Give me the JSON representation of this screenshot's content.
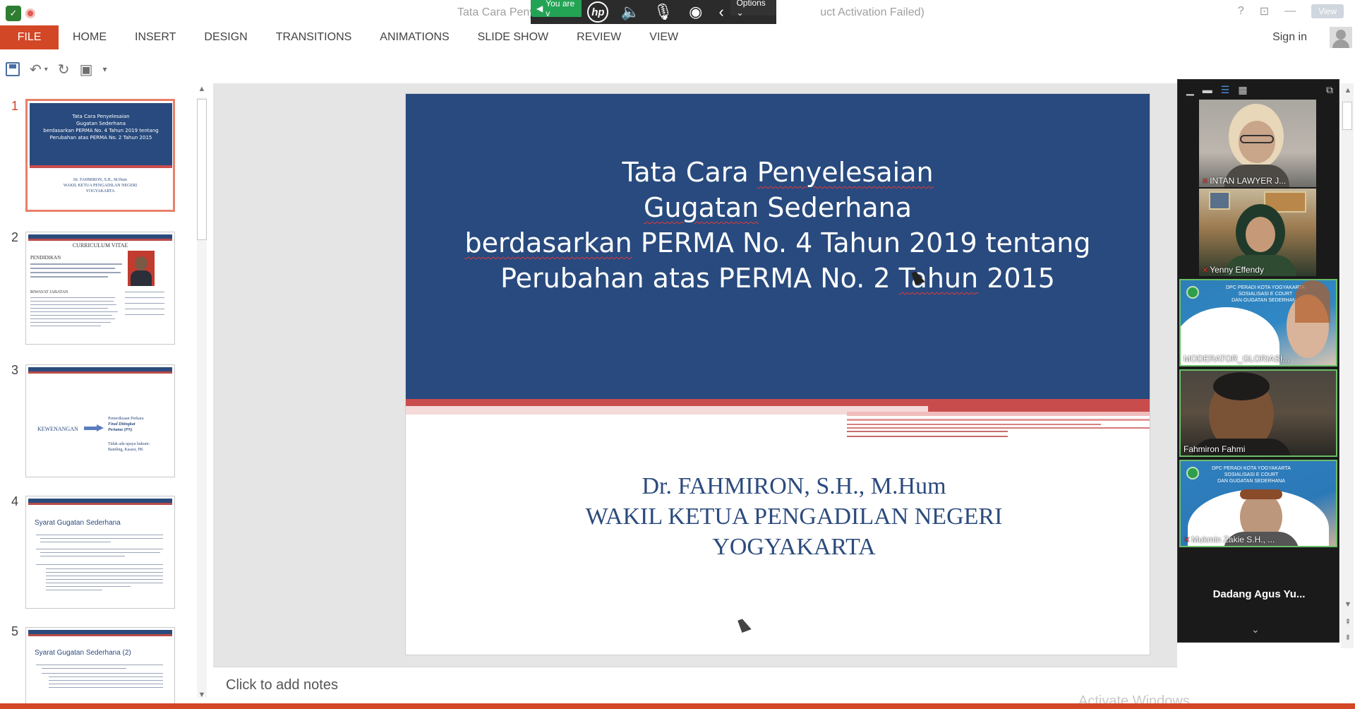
{
  "window": {
    "title_left": "Tata Cara Penye",
    "title_right": "uct Activation Failed)",
    "help_glyph": "?",
    "view_label": "View"
  },
  "share_toolbar": {
    "status_label": "You are v",
    "options_label": "Options ⌄",
    "status_color": "#23a455"
  },
  "ribbon": {
    "file_tab": "FILE",
    "tabs": [
      "HOME",
      "INSERT",
      "DESIGN",
      "TRANSITIONS",
      "ANIMATIONS",
      "SLIDE SHOW",
      "REVIEW",
      "VIEW"
    ],
    "sign_in": "Sign in",
    "accent_color": "#d24726"
  },
  "quick_access": {
    "icons": [
      "save-icon",
      "undo-icon",
      "redo-icon",
      "start-from-beginning-icon",
      "customize-icon"
    ]
  },
  "thumbnails": {
    "selected_index": 1,
    "items": [
      {
        "number": "1",
        "lines": [
          "Tata Cara Penyelesaian",
          "Gugatan Sederhana",
          "berdasarkan PERMA No. 4 Tahun 2019 tentang",
          "Perubahan atas PERMA No. 2 Tahun 2015"
        ],
        "sub": [
          "Dr. FAHMIRON, S.H., M.Hum",
          "WAKIL KETUA PENGADILAN NEGERI",
          "YOGYAKARTA"
        ]
      },
      {
        "number": "2",
        "title": "CURRICULUM VITAE",
        "heading": "PENDIDIKAN",
        "heading2": "RIWAYAT JABATAN"
      },
      {
        "number": "3",
        "left": "KEWENANGAN",
        "right": [
          "Pemeriksaan Perkara",
          "Final Ditingkat",
          "Pertama (PN)"
        ],
        "note": [
          "Tidak ada upaya hukum:",
          "Banding, Kasasi, PK"
        ]
      },
      {
        "number": "4",
        "title": "Syarat Gugatan Sederhana"
      },
      {
        "number": "5",
        "title": "Syarat Gugatan Sederhana (2)"
      }
    ]
  },
  "slide": {
    "title_lines": [
      {
        "parts": [
          "Tata Cara ",
          "Penyelesaian",
          ""
        ]
      },
      {
        "parts": [
          "",
          "Gugatan",
          " Sederhana"
        ]
      },
      {
        "parts": [
          "",
          "berdasarkan",
          " PERMA No. 4 Tahun 2019 tentang"
        ]
      },
      {
        "parts": [
          "Perubahan atas PERMA No. 2 ",
          "Tahun",
          " 2015"
        ]
      }
    ],
    "subtitle_lines": [
      "Dr. FAHMIRON, S.H., M.Hum",
      "WAKIL KETUA  PENGADILAN NEGERI",
      "YOGYAKARTA"
    ],
    "bg_color": "#284a7e",
    "stripe_color": "#c94c4c"
  },
  "notes": {
    "placeholder": "Click to add notes"
  },
  "gallery": {
    "participants": [
      {
        "name": "INTAN LAWYER J...",
        "muted": true
      },
      {
        "name": "Yenny Effendy",
        "muted": true
      },
      {
        "name": "MODERATOR_GLORIASI...",
        "muted": false
      },
      {
        "name": "Fahmiron Fahmi",
        "muted": false
      },
      {
        "name": "Mukmin Zakie S.H., ...",
        "muted": true
      }
    ],
    "bottom_name": "Dadang Agus Yu...",
    "banner_line": "DPC PERADI KOTA YOGYAKARTA",
    "banner_line2": "SOSIALISASI E COURT",
    "banner_line3": "DAN GUGATAN SEDERHANA"
  },
  "watermark": "Activate Windows"
}
